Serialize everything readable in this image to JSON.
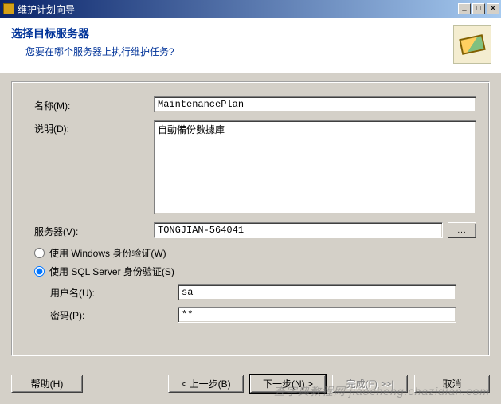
{
  "window": {
    "title": "维护计划向导",
    "minimize": "_",
    "maximize": "□",
    "close": "×"
  },
  "header": {
    "title": "选择目标服务器",
    "subtitle": "您要在哪个服务器上执行维护任务?"
  },
  "form": {
    "name_label": "名称(M):",
    "name_value": "MaintenancePlan",
    "desc_label": "说明(D):",
    "desc_value": "自動備份數據庫",
    "server_label": "服务器(V):",
    "server_value": "TONGJIAN-564041",
    "browse": "...",
    "auth_windows": "使用 Windows 身份验证(W)",
    "auth_sql": "使用 SQL Server 身份验证(S)",
    "user_label": "用户名(U):",
    "user_value": "sa",
    "pass_label": "密码(P):",
    "pass_value": "**"
  },
  "buttons": {
    "help": "帮助(H)",
    "back": "< 上一步(B)",
    "next": "下一步(N) >",
    "finish": "完成(F) >>|",
    "cancel": "取消"
  },
  "watermark": "查字典教程网 jiaocheng.chazidian.com"
}
